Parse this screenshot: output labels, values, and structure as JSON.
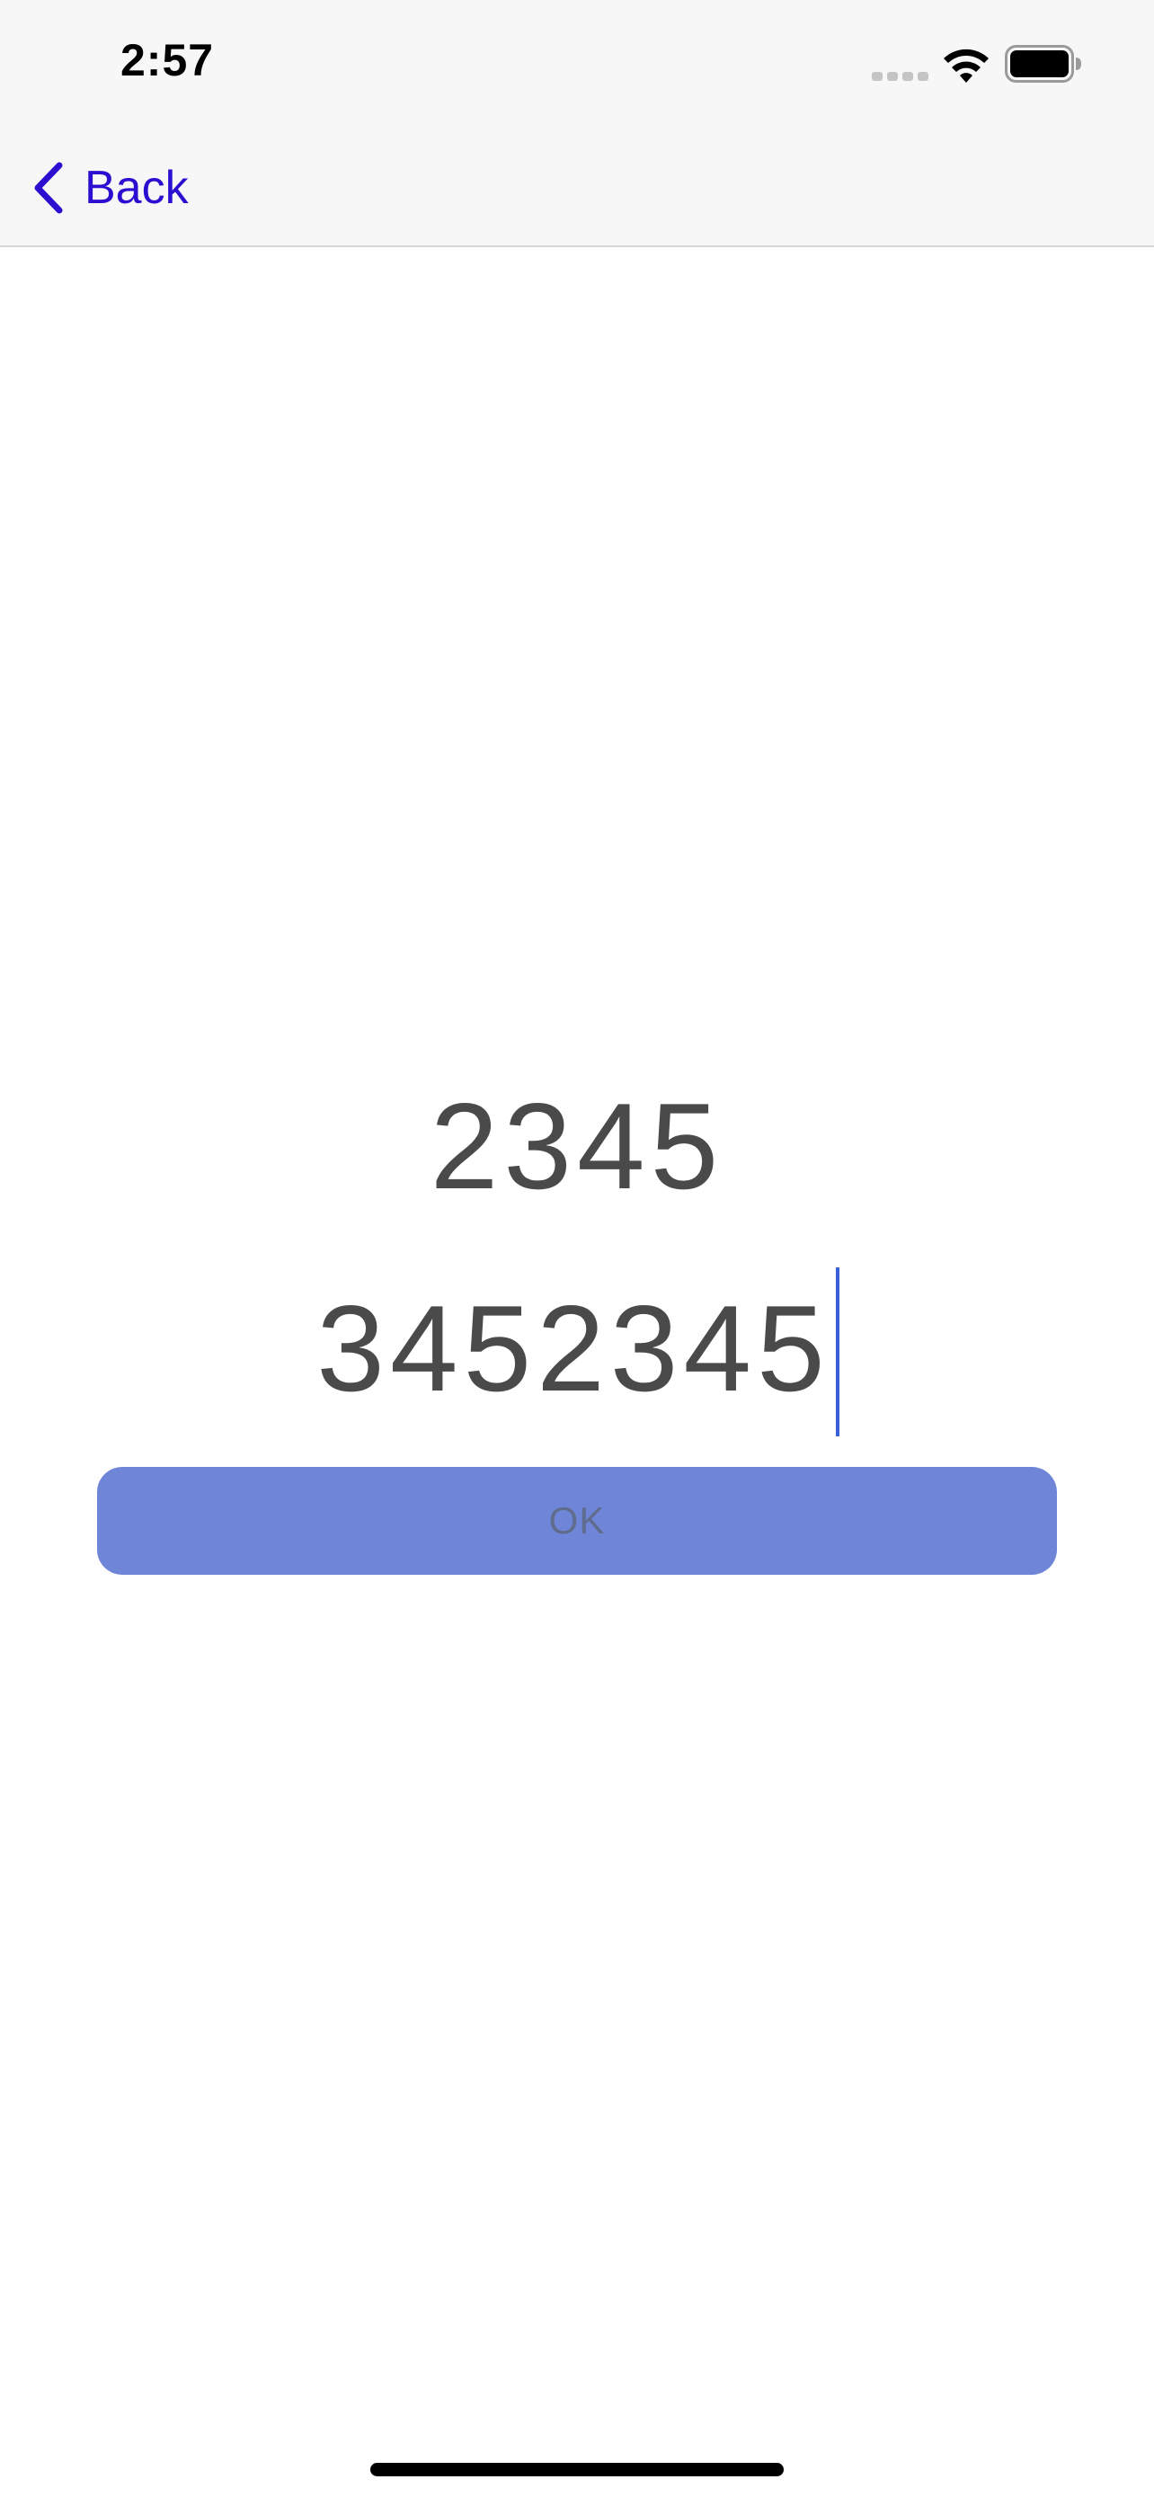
{
  "status_bar": {
    "time": "2:57"
  },
  "nav": {
    "back_label": "Back"
  },
  "main": {
    "value_label": "2345",
    "input_value": "3452345",
    "ok_label": "OK"
  },
  "colors": {
    "accent": "#2a0fd0",
    "button": "#6f86d8",
    "text": "#4a4a4a",
    "caret": "#3a5fd8"
  },
  "icons": [
    "wifi-icon",
    "battery-icon",
    "signal-dots-icon",
    "chevron-left-icon"
  ]
}
